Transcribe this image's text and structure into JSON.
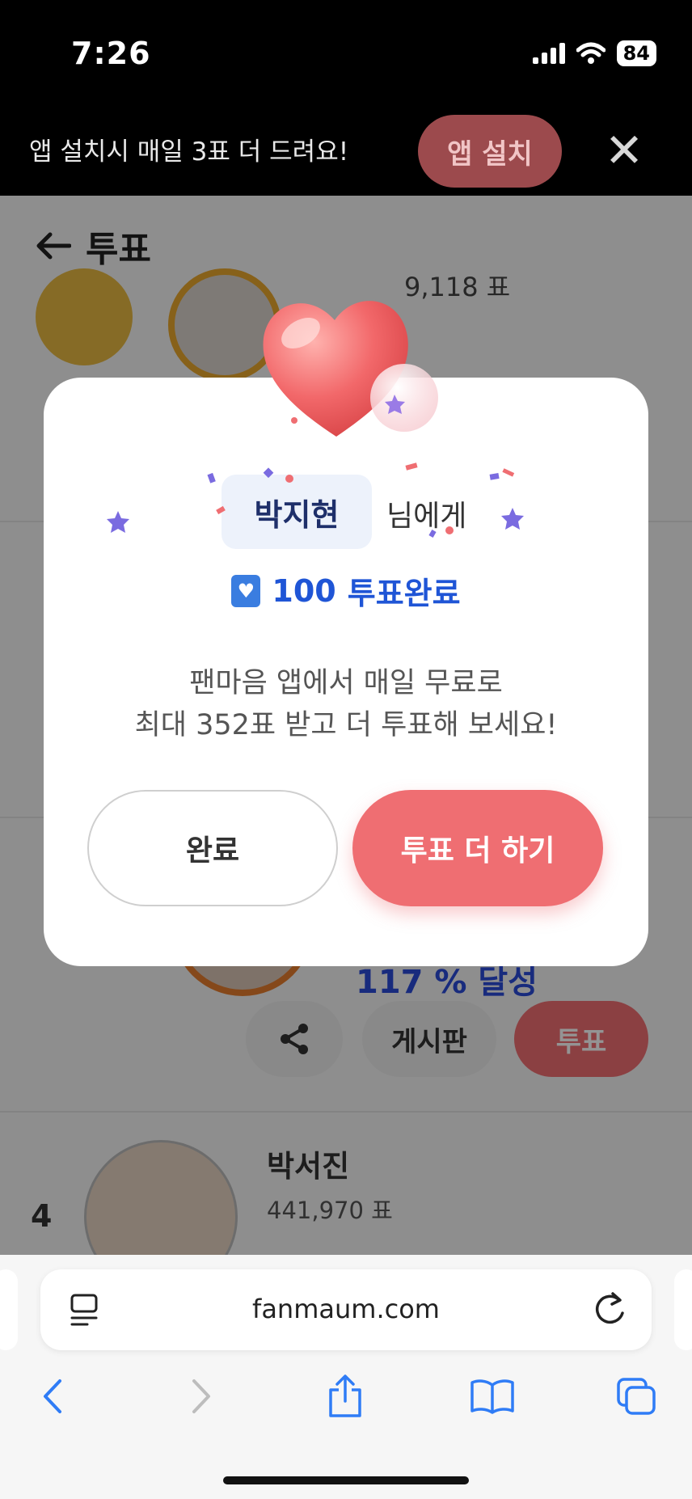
{
  "status_bar": {
    "time": "7:26",
    "battery": "84"
  },
  "install_banner": {
    "text": "앱 설치시 매일 3표 더 드려요!",
    "button": "앱 설치",
    "close": "✕"
  },
  "page": {
    "title": "투표",
    "row1_votes_partial": "9,118 표",
    "row3_achieve": "117 % 달성",
    "row3_board": "게시판",
    "row3_vote": "투표",
    "row4": {
      "rank": "4",
      "name": "박서진",
      "votes": "441,970 표"
    }
  },
  "modal": {
    "name": "박지현",
    "name_suffix": "님에게",
    "vote_count": "100",
    "vote_done_label": "투표완료",
    "message_line1": "팬마음 앱에서 매일 무료로",
    "message_line2": "최대 352표 받고 더 투표해 보세요!",
    "done_button": "완료",
    "more_button": "투표 더 하기"
  },
  "browser": {
    "url": "fanmaum.com"
  },
  "colors": {
    "accent": "#ef6e72",
    "blue": "#1f55d6"
  }
}
